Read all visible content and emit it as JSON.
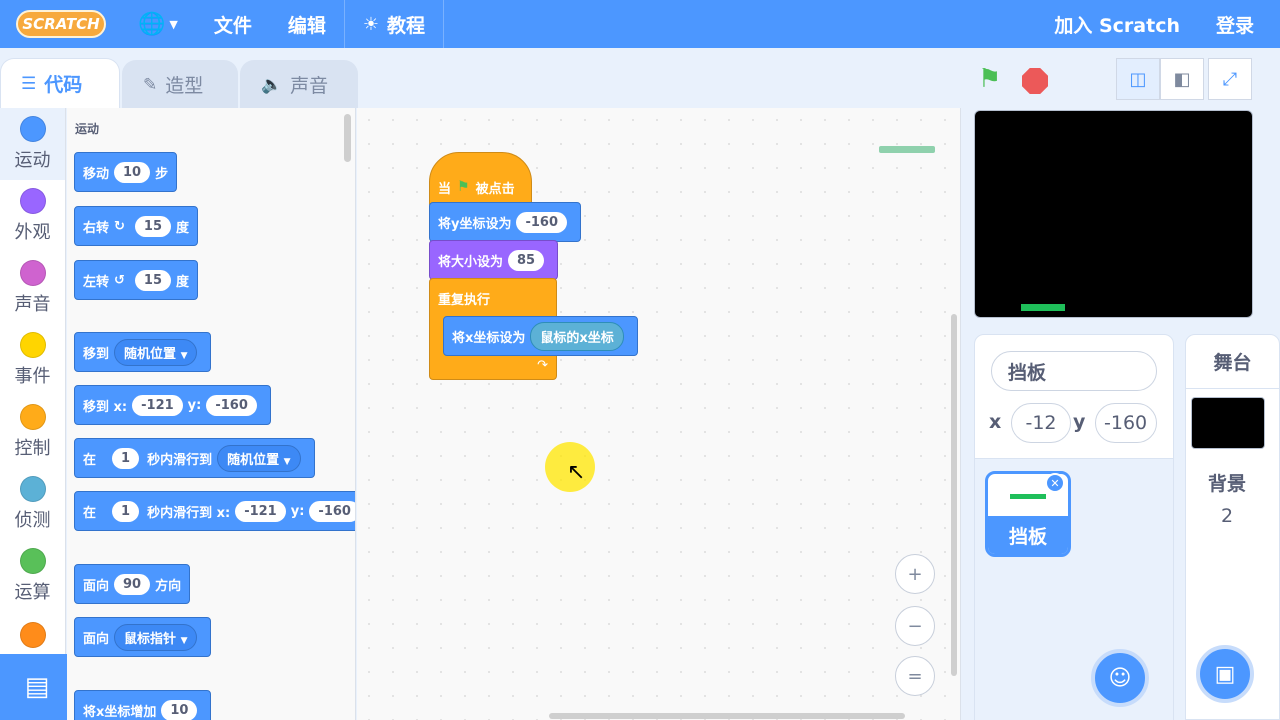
{
  "topbar": {
    "logo": "SCRATCH",
    "file": "文件",
    "edit": "编辑",
    "tutorials": "教程",
    "join": "加入 Scratch",
    "signin": "登录"
  },
  "tabs": {
    "code": "代码",
    "costumes": "造型",
    "sounds": "声音"
  },
  "categories": [
    {
      "label": "运动",
      "color": "#4c97ff"
    },
    {
      "label": "外观",
      "color": "#9966ff"
    },
    {
      "label": "声音",
      "color": "#cf63cf"
    },
    {
      "label": "事件",
      "color": "#ffd500"
    },
    {
      "label": "控制",
      "color": "#ffab19"
    },
    {
      "label": "侦测",
      "color": "#5cb1d6"
    },
    {
      "label": "运算",
      "color": "#59c059"
    },
    {
      "label": "",
      "color": "#ff8c1a"
    }
  ],
  "palette": {
    "section_title": "运动",
    "move": {
      "a": "移动",
      "v": "10",
      "b": "步"
    },
    "turn_right": {
      "a": "右转",
      "icon": "rotate-cw-icon",
      "v": "15",
      "b": "度"
    },
    "turn_left": {
      "a": "左转",
      "icon": "rotate-ccw-icon",
      "v": "15",
      "b": "度"
    },
    "goto": {
      "a": "移到",
      "dd": "随机位置"
    },
    "goto_xy": {
      "a": "移到 x:",
      "x": "-121",
      "yl": "y:",
      "y": "-160"
    },
    "glide": {
      "a": "在",
      "v": "1",
      "b": "秒内滑行到",
      "dd": "随机位置"
    },
    "glide_xy": {
      "a": "在",
      "v": "1",
      "b": "秒内滑行到 x:",
      "x": "-121",
      "yl": "y:",
      "y": "-160"
    },
    "point_dir": {
      "a": "面向",
      "v": "90",
      "b": "方向"
    },
    "point_towards": {
      "a": "面向",
      "dd": "鼠标指针"
    },
    "change_x": {
      "a": "将x坐标增加",
      "v": "10"
    }
  },
  "script": {
    "hat": {
      "a": "当",
      "b": "被点击"
    },
    "set_y": {
      "a": "将y坐标设为",
      "v": "-160"
    },
    "set_size": {
      "a": "将大小设为",
      "v": "85"
    },
    "forever": "重复执行",
    "set_x": {
      "a": "将x坐标设为",
      "r": "鼠标的x坐标"
    }
  },
  "zoom": {
    "in": "+",
    "out": "−",
    "reset": "="
  },
  "sprite_info": {
    "name": "挡板",
    "x_label": "x",
    "x": "-12",
    "y_label": "y",
    "y": "-160"
  },
  "sprites": [
    {
      "name": "挡板"
    }
  ],
  "stage_panel": {
    "title": "舞台",
    "backdrops_label": "背景",
    "backdrop_count": "2"
  },
  "colors": {
    "motion": "#4c97ff",
    "looks": "#9966ff",
    "control": "#ffab19",
    "sensing": "#5cb1d6",
    "paddle": "#1fbf5a"
  }
}
